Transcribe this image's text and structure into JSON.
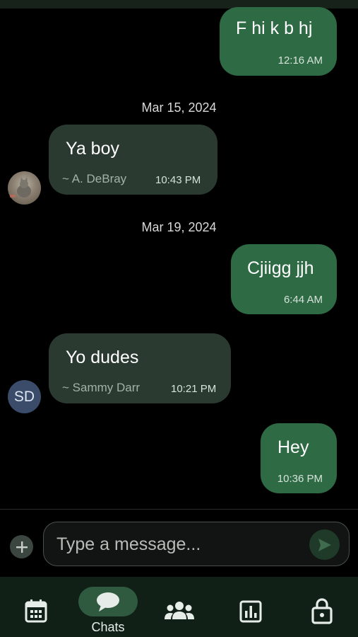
{
  "messages": [
    {
      "direction": "outgoing",
      "text": "F  hi k b hj",
      "time": "12:16 AM"
    },
    {
      "date_separator": "Mar 15, 2024"
    },
    {
      "direction": "incoming",
      "text": "Ya boy",
      "sender": "~ A. DeBray",
      "time": "10:43 PM",
      "avatar": "photo"
    },
    {
      "date_separator": "Mar 19, 2024"
    },
    {
      "direction": "outgoing",
      "text": "Cjiigg jjh",
      "time": "6:44 AM"
    },
    {
      "direction": "incoming",
      "text": "Yo dudes",
      "sender": "~ Sammy Darr",
      "time": "10:21 PM",
      "avatar_initials": "SD"
    },
    {
      "direction": "outgoing",
      "text": "Hey",
      "time": "10:36 PM"
    }
  ],
  "composer": {
    "placeholder": "Type a message...",
    "add_icon": "plus-icon",
    "send_icon": "send-icon"
  },
  "nav": {
    "items": [
      {
        "icon": "calendar-icon",
        "label": ""
      },
      {
        "icon": "chat-icon",
        "label": "Chats",
        "selected": true
      },
      {
        "icon": "people-icon",
        "label": ""
      },
      {
        "icon": "bar-chart-icon",
        "label": ""
      },
      {
        "icon": "lock-icon",
        "label": ""
      }
    ]
  },
  "colors": {
    "outgoing_bubble": "#2e6a44",
    "incoming_bubble": "#2b3a30",
    "nav_background": "#102016",
    "nav_selected_pill": "#2f5a40"
  }
}
